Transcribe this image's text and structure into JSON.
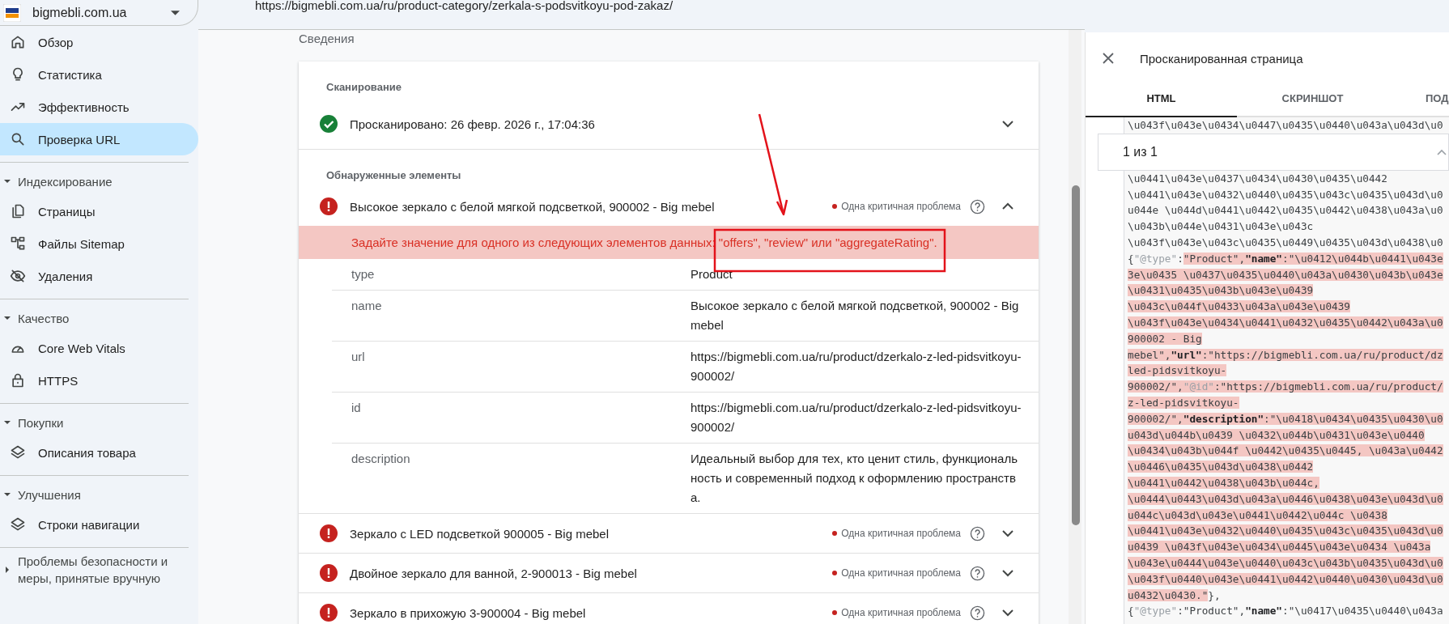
{
  "sidebar": {
    "site": "bigmebli.com.ua",
    "items": [
      {
        "label": "Обзор",
        "selected": false
      },
      {
        "label": "Статистика",
        "selected": false
      },
      {
        "label": "Эффективность",
        "selected": false
      },
      {
        "label": "Проверка URL",
        "selected": true
      }
    ],
    "sections": [
      {
        "title": "Индексирование",
        "expanded": true,
        "items": [
          {
            "label": "Страницы",
            "selected": false
          },
          {
            "label": "Файлы Sitemap",
            "selected": false
          },
          {
            "label": "Удаления",
            "selected": false
          }
        ]
      },
      {
        "title": "Качество",
        "expanded": true,
        "items": [
          {
            "label": "Core Web Vitals",
            "selected": false
          },
          {
            "label": "HTTPS",
            "selected": false
          }
        ]
      },
      {
        "title": "Покупки",
        "expanded": true,
        "items": [
          {
            "label": "Описания товара",
            "selected": false
          }
        ]
      },
      {
        "title": "Улучшения",
        "expanded": true,
        "items": [
          {
            "label": "Строки навигации",
            "selected": false
          }
        ]
      },
      {
        "title": "Проблемы безопасности и меры, принятые вручную",
        "expanded": false
      }
    ]
  },
  "page_url": "https://bigmebli.com.ua/ru/product-category/zerkala-s-podsvitkoyu-pod-zakaz/",
  "section_title": "Сведения",
  "scan": {
    "heading": "Сканирование",
    "status": "Просканировано: 26 февр. 2026 г., 17:04:36",
    "ok": true,
    "expanded": false
  },
  "detected": {
    "heading": "Обнаруженные элементы",
    "items": [
      {
        "title": "Высокое зеркало с белой мягкой подсветкой, 900002 - Big mebel",
        "issue": "Одна критичная проблема",
        "expanded": true,
        "error": "Задайте значение для одного из следующих элементов данных: \"offers\", \"review\" или \"aggregateRating\".",
        "properties": [
          {
            "name": "type",
            "value": "Product"
          },
          {
            "name": "name",
            "value": "Высокое зеркало с белой мягкой подсветкой, 900002 - Big mebel"
          },
          {
            "name": "url",
            "value": "https://bigmebli.com.ua/ru/product/dzerkalo-z-led-pidsvitkoyu-900002/"
          },
          {
            "name": "id",
            "value": "https://bigmebli.com.ua/ru/product/dzerkalo-z-led-pidsvitkoyu-900002/"
          },
          {
            "name": "description",
            "value": "Идеальный выбор для тех, кто ценит стиль, функциональность и современный подход к оформлению пространства."
          }
        ]
      },
      {
        "title": "Зеркало с LED подсветкой 900005 - Big mebel",
        "issue": "Одна критичная проблема",
        "expanded": false
      },
      {
        "title": "Двойное зеркало для ванной, 2-900013 - Big mebel",
        "issue": "Одна критичная проблема",
        "expanded": false
      },
      {
        "title": "Зеркало в прихожую 3-900004 - Big mebel",
        "issue": "Одна критичная проблема",
        "expanded": false
      }
    ]
  },
  "panel": {
    "title": "Просканированная страница",
    "tabs": [
      {
        "label": "HTML",
        "selected": true
      },
      {
        "label": "СКРИНШОТ",
        "selected": false
      },
      {
        "label": "ПОД",
        "selected": false
      }
    ],
    "search": {
      "value": "1 из 1"
    },
    "code_lines": [
      {
        "parts": [
          {
            "text": "\\u043f\\u043e\\u0434\\u0447\\u0435\\u0440\\u043a\\u043d\\u0",
            "kind": "text",
            "highlighted": false
          }
        ]
      },
      {
        "parts": [
          {
            "text": "\\u0441\\u043e\\u0437\\u0434\\u0430\\u0435\\u0442",
            "kind": "text",
            "highlighted": false
          }
        ]
      },
      {
        "parts": [
          {
            "text": "\\u0441\\u043e\\u0432\\u0440\\u0435\\u043c\\u0435\\u043d\\u0",
            "kind": "text",
            "highlighted": false
          }
        ]
      },
      {
        "parts": [
          {
            "text": "u044e \\u044d\\u0441\\u0442\\u0435\\u0442\\u0438\\u043a\\u0",
            "kind": "text",
            "highlighted": false
          }
        ]
      },
      {
        "parts": [
          {
            "text": "\\u043b\\u044e\\u0431\\u043e\\u043c",
            "kind": "text",
            "highlighted": false
          }
        ]
      },
      {
        "parts": [
          {
            "text": "\\u043f\\u043e\\u043c\\u0435\\u0449\\u0435\\u043d\\u0438\\u0",
            "kind": "text",
            "highlighted": false
          }
        ]
      },
      {
        "parts": [
          {
            "text": "{",
            "kind": "text",
            "highlighted": false
          },
          {
            "text": "\"@type\"",
            "kind": "meta",
            "highlighted": false
          },
          {
            "text": ":",
            "kind": "text",
            "highlighted": false
          },
          {
            "text": "\"Product\",",
            "kind": "text",
            "highlighted": true
          },
          {
            "text": "\"name\"",
            "kind": "key",
            "highlighted": true
          },
          {
            "text": ":\"\\u0412\\u044b\\u0441\\u043e",
            "kind": "text",
            "highlighted": true
          }
        ]
      },
      {
        "parts": [
          {
            "text": "3e\\u0435 \\u0437\\u0435\\u0440\\u043a\\u0430\\u043b\\u043e",
            "kind": "text",
            "highlighted": true
          }
        ]
      },
      {
        "parts": [
          {
            "text": "\\u0431\\u0435\\u043b\\u043e\\u0439",
            "kind": "text",
            "highlighted": true
          }
        ]
      },
      {
        "parts": [
          {
            "text": "\\u043c\\u044f\\u0433\\u043a\\u043e\\u0439",
            "kind": "text",
            "highlighted": true
          }
        ]
      },
      {
        "parts": [
          {
            "text": "\\u043f\\u043e\\u0434\\u0441\\u0432\\u0435\\u0442\\u043a\\u0",
            "kind": "text",
            "highlighted": true
          }
        ]
      },
      {
        "parts": [
          {
            "text": "900002 - Big",
            "kind": "text",
            "highlighted": true
          }
        ]
      },
      {
        "parts": [
          {
            "text": "mebel\",",
            "kind": "text",
            "highlighted": true
          },
          {
            "text": "\"url\"",
            "kind": "key",
            "highlighted": true
          },
          {
            "text": ":\"https://bigmebli.com.ua/ru/product/dz",
            "kind": "text",
            "highlighted": true
          }
        ]
      },
      {
        "parts": [
          {
            "text": "led-pidsvitkoyu-",
            "kind": "text",
            "highlighted": true
          }
        ]
      },
      {
        "parts": [
          {
            "text": "900002/\",",
            "kind": "text",
            "highlighted": true
          },
          {
            "text": "\"@id\"",
            "kind": "meta",
            "highlighted": true
          },
          {
            "text": ":\"https://bigmebli.com.ua/ru/product/",
            "kind": "text",
            "highlighted": true
          }
        ]
      },
      {
        "parts": [
          {
            "text": "z-led-pidsvitkoyu-",
            "kind": "text",
            "highlighted": true
          }
        ]
      },
      {
        "parts": [
          {
            "text": "900002/\",",
            "kind": "text",
            "highlighted": true
          },
          {
            "text": "\"description\"",
            "kind": "key",
            "highlighted": true
          },
          {
            "text": ":\"\\u0418\\u0434\\u0435\\u0430\\u0",
            "kind": "text",
            "highlighted": true
          }
        ]
      },
      {
        "parts": [
          {
            "text": "u043d\\u044b\\u0439 \\u0432\\u044b\\u0431\\u043e\\u0440",
            "kind": "text",
            "highlighted": true
          }
        ]
      },
      {
        "parts": [
          {
            "text": "\\u0434\\u043b\\u044f \\u0442\\u0435\\u0445, \\u043a\\u0442",
            "kind": "text",
            "highlighted": true
          }
        ]
      },
      {
        "parts": [
          {
            "text": "\\u0446\\u0435\\u043d\\u0438\\u0442",
            "kind": "text",
            "highlighted": true
          }
        ]
      },
      {
        "parts": [
          {
            "text": "\\u0441\\u0442\\u0438\\u043b\\u044c,",
            "kind": "text",
            "highlighted": true
          }
        ]
      },
      {
        "parts": [
          {
            "text": "\\u0444\\u0443\\u043d\\u043a\\u0446\\u0438\\u043e\\u043d\\u0",
            "kind": "text",
            "highlighted": true
          }
        ]
      },
      {
        "parts": [
          {
            "text": "u044c\\u043d\\u043e\\u0441\\u0442\\u044c \\u0438",
            "kind": "text",
            "highlighted": true
          }
        ]
      },
      {
        "parts": [
          {
            "text": "\\u0441\\u043e\\u0432\\u0440\\u0435\\u043c\\u0435\\u043d\\u0",
            "kind": "text",
            "highlighted": true
          }
        ]
      },
      {
        "parts": [
          {
            "text": "u0439 \\u043f\\u043e\\u0434\\u0445\\u043e\\u0434 \\u043a",
            "kind": "text",
            "highlighted": true
          }
        ]
      },
      {
        "parts": [
          {
            "text": "\\u043e\\u0444\\u043e\\u0440\\u043c\\u043b\\u0435\\u043d\\u0",
            "kind": "text",
            "highlighted": true
          }
        ]
      },
      {
        "parts": [
          {
            "text": "\\u043f\\u0440\\u043e\\u0441\\u0442\\u0440\\u0430\\u043d\\u0",
            "kind": "text",
            "highlighted": true
          }
        ]
      },
      {
        "parts": [
          {
            "text": "u0432\\u0430.\"",
            "kind": "text",
            "highlighted": true
          },
          {
            "text": "},",
            "kind": "text",
            "highlighted": false
          }
        ]
      },
      {
        "parts": [
          {
            "text": "{",
            "kind": "text",
            "highlighted": false
          },
          {
            "text": "\"@type\"",
            "kind": "meta",
            "highlighted": false
          },
          {
            "text": ":\"Product\",",
            "kind": "text",
            "highlighted": false
          },
          {
            "text": "\"name\"",
            "kind": "key",
            "highlighted": false
          },
          {
            "text": ":\"\\u0417\\u0435\\u0440\\u043a",
            "kind": "text",
            "highlighted": false
          }
        ]
      }
    ]
  }
}
